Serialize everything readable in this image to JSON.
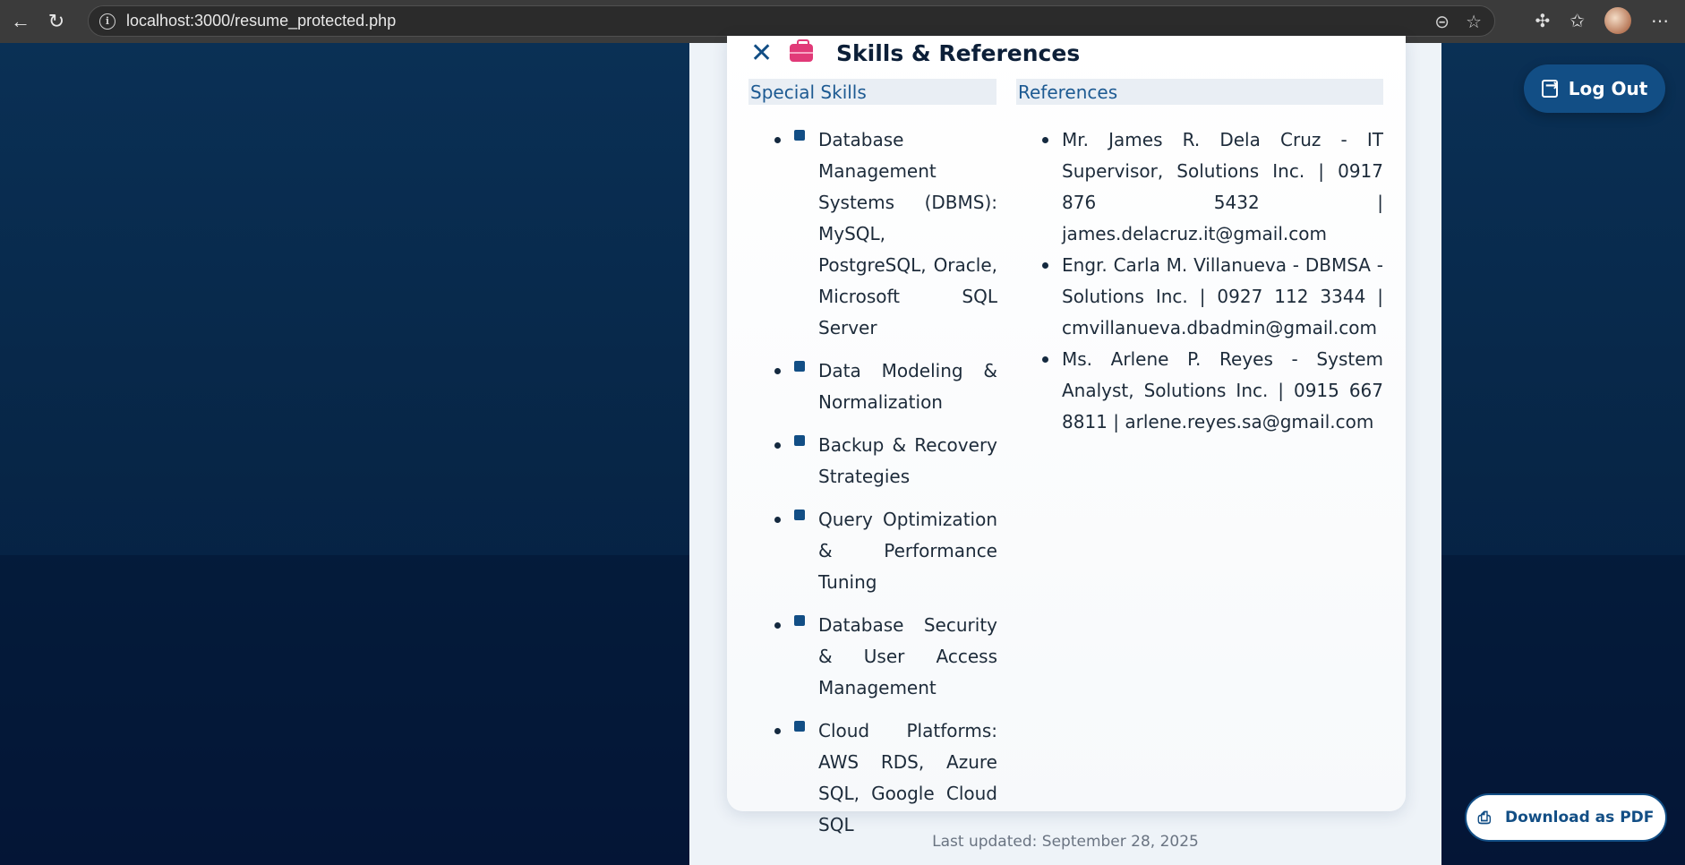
{
  "browser": {
    "url": "localhost:3000/resume_protected.php",
    "back_icon": "←",
    "reload_icon": "↻"
  },
  "section": {
    "title": "Skills & References"
  },
  "skills": {
    "heading": "Special Skills",
    "items": [
      "Database Management Systems (DBMS): MySQL, PostgreSQL, Oracle, Microsoft SQL Server",
      "Data Modeling & Normalization",
      "Backup & Recovery Strategies",
      "Query Optimization & Performance Tuning",
      "Database Security & User Access Management",
      "Cloud Platforms: AWS RDS, Azure SQL, Google Cloud SQL"
    ]
  },
  "references": {
    "heading": "References",
    "items": [
      "Mr. James R. Dela Cruz - IT Supervisor, Solutions Inc. | 0917 876 5432 | james.delacruz.it@gmail.com",
      "Engr. Carla M. Villanueva - DBMSA - Solutions Inc. | 0927 112 3344 | cmvillanueva.dbadmin@gmail.com",
      "Ms. Arlene P. Reyes - System Analyst, Solutions Inc. | 0915 667 8811 | arlene.reyes.sa@gmail.com"
    ]
  },
  "footer": {
    "last_updated": "Last updated: September 28, 2025"
  },
  "actions": {
    "logout_label": "Log Out",
    "download_label": "Download as PDF"
  },
  "colors": {
    "accent": "#124e85",
    "brief_icon": "#e13a78"
  }
}
